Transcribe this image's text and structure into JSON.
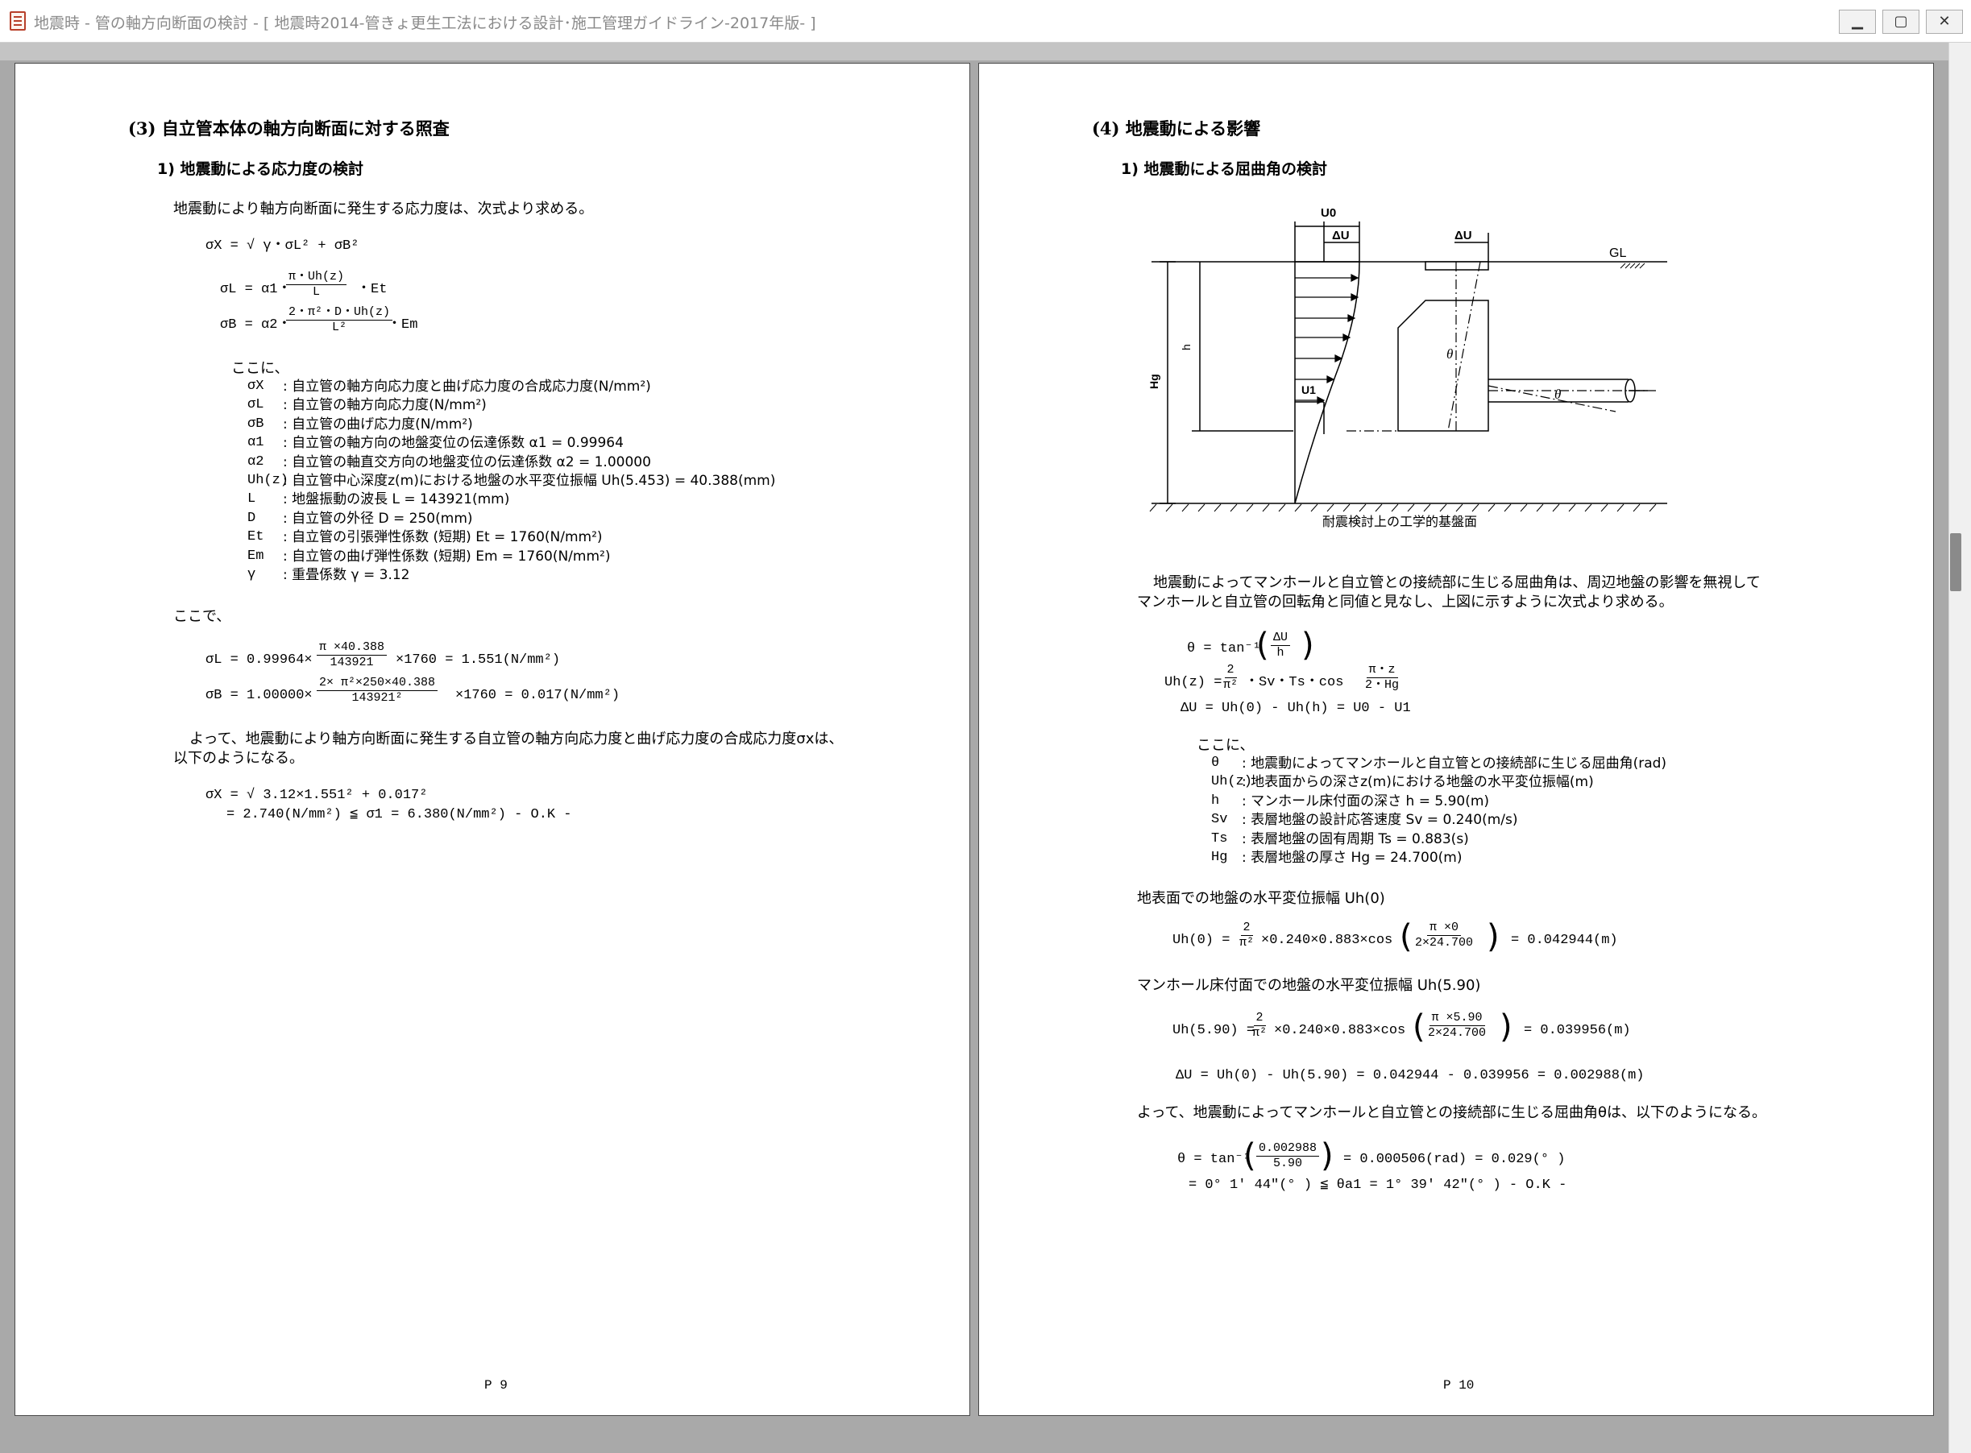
{
  "window": {
    "title": "地震時 - 管の軸方向断面の検討 - [ 地震時2014-管きょ更生工法における設計･施工管理ガイドライン-2017年版- ]",
    "btn_min": "▁",
    "btn_max": "▢",
    "btn_close": "✕"
  },
  "p9": {
    "heading": "(3) 自立管本体の軸方向断面に対する照査",
    "sub": "1) 地震動による応力度の検討",
    "intro": "地震動により軸方向断面に発生する応力度は、次式より求める。",
    "f1": "σX = √ γ・σL² + σB²",
    "f2_lhs": "σL = α1・",
    "f2_num": "π・Uh(z)",
    "f2_den": "L",
    "f2_tail": "・Et",
    "f3_lhs": "σB = α2・",
    "f3_num": "2・π²・D・Uh(z)",
    "f3_den": "L²",
    "f3_tail": "・Em",
    "koko": "ここに、",
    "defs": [
      {
        "sym": "σX",
        "desc": ": 自立管の軸方向応力度と曲げ応力度の合成応力度(N/mm²)"
      },
      {
        "sym": "σL",
        "desc": ": 自立管の軸方向応力度(N/mm²)"
      },
      {
        "sym": "σB",
        "desc": ": 自立管の曲げ応力度(N/mm²)"
      },
      {
        "sym": "α1",
        "desc": ": 自立管の軸方向の地盤変位の伝達係数 α1 = 0.99964"
      },
      {
        "sym": "α2",
        "desc": ": 自立管の軸直交方向の地盤変位の伝達係数 α2 = 1.00000"
      },
      {
        "sym": "Uh(z)",
        "desc": ": 自立管中心深度z(m)における地盤の水平変位振幅 Uh(5.453) = 40.388(mm)"
      },
      {
        "sym": "L",
        "desc": ": 地盤振動の波長 L = 143921(mm)"
      },
      {
        "sym": "D",
        "desc": ": 自立管の外径 D = 250(mm)"
      },
      {
        "sym": "Et",
        "desc": ": 自立管の引張弾性係数 (短期)  Et = 1760(N/mm²)"
      },
      {
        "sym": "Em",
        "desc": ": 自立管の曲げ弾性係数 (短期)  Em = 1760(N/mm²)"
      },
      {
        "sym": "γ",
        "desc": ": 重畳係数 γ = 3.12"
      }
    ],
    "kokode": "ここで、",
    "c1_lhs": "σL = 0.99964×",
    "c1_num": "π ×40.388",
    "c1_den": "143921",
    "c1_tail": "×1760 = 1.551(N/mm²)",
    "c2_lhs": "σB = 1.00000×",
    "c2_num": "2× π²×250×40.388",
    "c2_den": "143921²",
    "c2_tail": "×1760 = 0.017(N/mm²)",
    "concl1": "よって、地震動により軸方向断面に発生する自立管の軸方向応力度と曲げ応力度の合成応力度σxは、",
    "concl2": "以下のようになる。",
    "r1": "σX = √ 3.12×1.551² + 0.017²",
    "r2": "= 2.740(N/mm²) ≦  σ1 = 6.380(N/mm²)  - O.K -",
    "page_no": "P 9"
  },
  "p10": {
    "heading": "(4) 地震動による影響",
    "sub": "1) 地震動による屈曲角の検討",
    "fig": {
      "u0": "U0",
      "du1": "ΔU",
      "du2": "ΔU",
      "gl": "GL",
      "h": "h",
      "hg": "Hg",
      "u1": "U1",
      "theta1": "θ",
      "theta2": "θ",
      "base": "耐震検討上の工学的基盤面"
    },
    "para1": "地震動によってマンホールと自立管との接続部に生じる屈曲角は、周辺地盤の影響を無視して",
    "para2": "マンホールと自立管の回転角と同値と見なし、上図に示すように次式より求める。",
    "e1_lhs": "θ = tan⁻¹",
    "e1_num": "ΔU",
    "e1_den": "h",
    "e2_lhs": "Uh(z) =",
    "e2_num": "2",
    "e2_den": "π²",
    "e2_mid": "・Sv・Ts・cos",
    "e2_num2": "π・z",
    "e2_den2": "2・Hg",
    "e3": "ΔU = Uh(0) - Uh(h) = U0 - U1",
    "koko": "ここに、",
    "defs": [
      {
        "sym": "θ",
        "desc": ": 地震動によってマンホールと自立管との接続部に生じる屈曲角(rad)"
      },
      {
        "sym": "Uh(z)",
        "desc": ": 地表面からの深さz(m)における地盤の水平変位振幅(m)"
      },
      {
        "sym": "h",
        "desc": ": マンホール床付面の深さ h = 5.90(m)"
      },
      {
        "sym": "Sv",
        "desc": ": 表層地盤の設計応答速度 Sv = 0.240(m/s)"
      },
      {
        "sym": "Ts",
        "desc": ": 表層地盤の固有周期 Ts = 0.883(s)"
      },
      {
        "sym": "Hg",
        "desc": ": 表層地盤の厚さ Hg = 24.700(m)"
      }
    ],
    "s1": "地表面での地盤の水平変位振幅 Uh(0)",
    "u0_lhs": "Uh(0) =",
    "u0_num": "2",
    "u0_den": "π²",
    "u0_mid": "×0.240×0.883×cos",
    "u0_num2": "π ×0",
    "u0_den2": "2×24.700",
    "u0_res": "= 0.042944(m)",
    "s2": "マンホール床付面での地盤の水平変位振幅 Uh(5.90)",
    "u5_lhs": "Uh(5.90) =",
    "u5_num": "2",
    "u5_den": "π²",
    "u5_mid": "×0.240×0.883×cos",
    "u5_num2": "π ×5.90",
    "u5_den2": "2×24.700",
    "u5_res": "= 0.039956(m)",
    "du": "ΔU = Uh(0) - Uh(5.90) = 0.042944 - 0.039956 = 0.002988(m)",
    "concl": "よって、地震動によってマンホールと自立管との接続部に生じる屈曲角θは、以下のようになる。",
    "t_lhs": "θ = tan⁻¹",
    "t_num": "0.002988",
    "t_den": "5.90",
    "t_res": "= 0.000506(rad) = 0.029(° )",
    "t2": "=  0°  1′ 44″(° ) ≦  θa1 =  1°  39′ 42″(° )  - O.K -",
    "page_no": "P 10"
  }
}
